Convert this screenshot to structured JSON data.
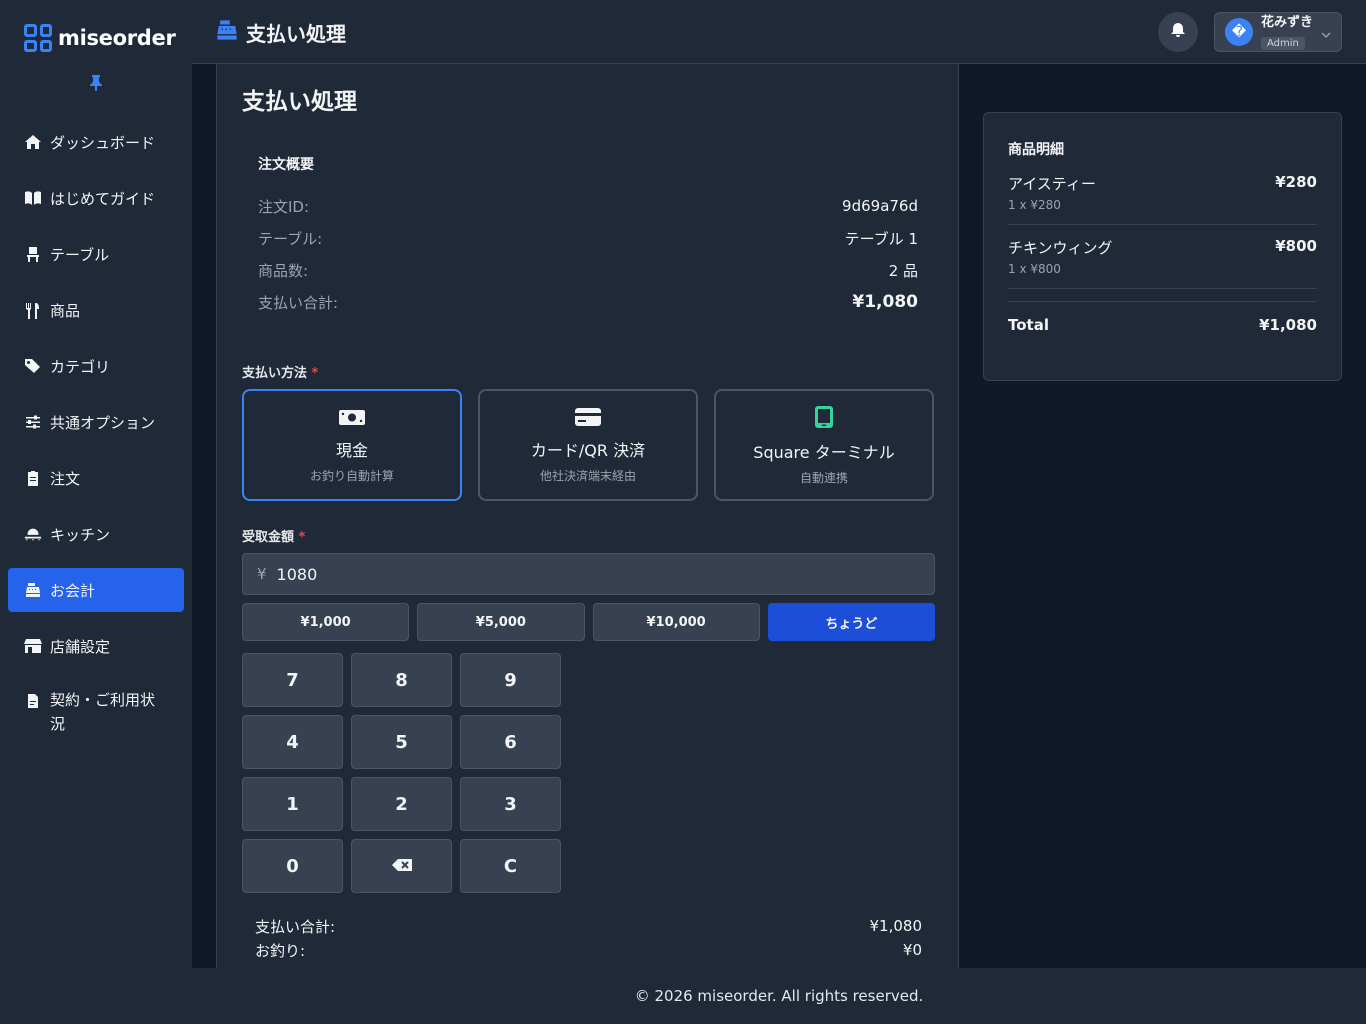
{
  "brand": {
    "name": "miseorder"
  },
  "sidebar": {
    "items": [
      {
        "label": "ダッシュボード",
        "icon": "home-icon"
      },
      {
        "label": "はじめてガイド",
        "icon": "book-icon"
      },
      {
        "label": "テーブル",
        "icon": "chair-icon"
      },
      {
        "label": "商品",
        "icon": "utensils-icon"
      },
      {
        "label": "カテゴリ",
        "icon": "tags-icon"
      },
      {
        "label": "共通オプション",
        "icon": "sliders-icon"
      },
      {
        "label": "注文",
        "icon": "clipboard-icon"
      },
      {
        "label": "キッチン",
        "icon": "kitchen-icon"
      },
      {
        "label": "お会計",
        "icon": "cash-register-icon",
        "active": true
      },
      {
        "label": "店舗設定",
        "icon": "store-icon"
      },
      {
        "label": "契約・ご利用状況",
        "icon": "contract-icon"
      }
    ]
  },
  "header": {
    "title": "支払い処理",
    "user": {
      "name": "花みずき",
      "role": "Admin",
      "avatar_glyph": "�"
    }
  },
  "main": {
    "title": "支払い処理",
    "summary": {
      "heading": "注文概要",
      "rows": [
        {
          "key": "注文ID:",
          "value": "9d69a76d"
        },
        {
          "key": "テーブル:",
          "value": "テーブル 1"
        },
        {
          "key": "商品数:",
          "value": "2 品"
        },
        {
          "key": "支払い合計:",
          "value": "¥1,080"
        }
      ]
    },
    "payment_method": {
      "label": "支払い方法",
      "required_mark": "*",
      "options": [
        {
          "label": "現金",
          "sub": "お釣り自動計算",
          "icon": "cash-icon",
          "selected": true
        },
        {
          "label": "カード/QR 決済",
          "sub": "他社決済端末経由",
          "icon": "credit-card-icon"
        },
        {
          "label": "Square ターミナル",
          "sub": "自動連携",
          "icon": "tablet-icon"
        }
      ]
    },
    "received": {
      "label": "受取金額",
      "required_mark": "*",
      "currency": "¥",
      "value": "1080"
    },
    "quick_amounts": [
      "¥1,000",
      "¥5,000",
      "¥10,000",
      "ちょうど"
    ],
    "keypad": [
      "7",
      "8",
      "9",
      "4",
      "5",
      "6",
      "1",
      "2",
      "3",
      "0",
      "",
      "C"
    ],
    "calc": {
      "total_label": "支払い合計:",
      "total_value": "¥1,080",
      "change_label": "お釣り:",
      "change_value": "¥0"
    }
  },
  "detail": {
    "heading": "商品明細",
    "items": [
      {
        "name": "アイスティー",
        "price": "¥280",
        "sub": "1 x ¥280"
      },
      {
        "name": "チキンウィング",
        "price": "¥800",
        "sub": "1 x ¥800"
      }
    ],
    "total_label": "Total",
    "total_value": "¥1,080"
  },
  "footer": {
    "text": "© 2026 miseorder. All rights reserved."
  },
  "colors": {
    "accent": "#2563eb",
    "bg": "#111827",
    "panel": "#1f2937",
    "square_icon": "#34d399"
  }
}
